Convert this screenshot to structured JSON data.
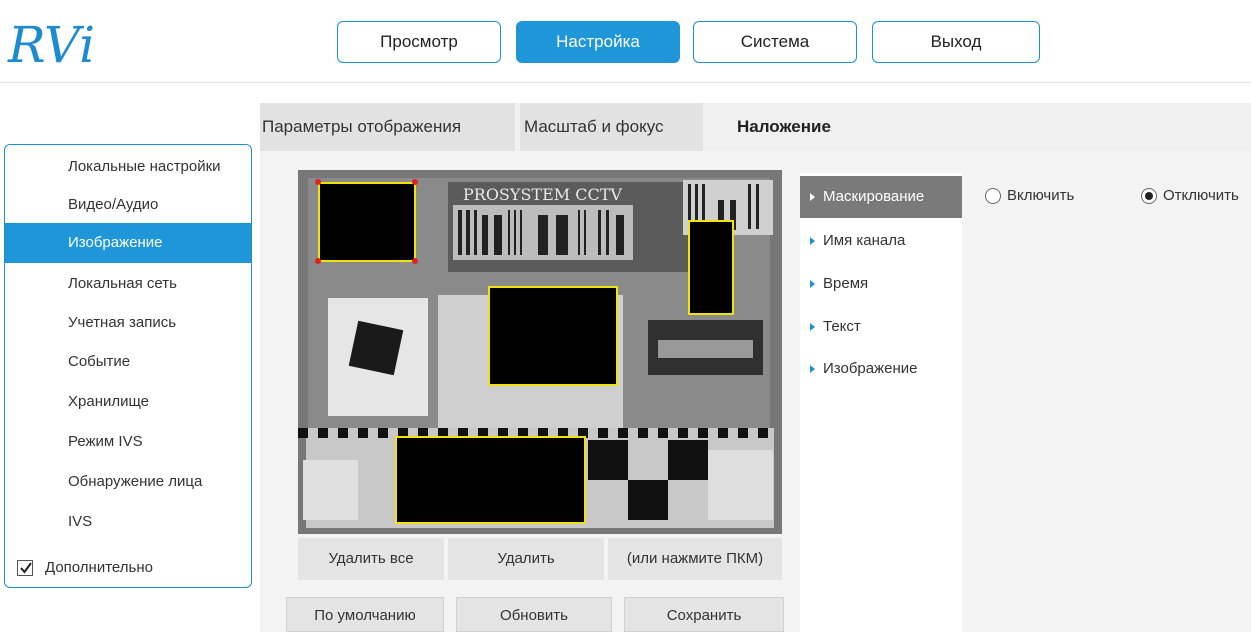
{
  "logo_text": "RVi",
  "colors": {
    "accent": "#1e96d8",
    "mask_border": "#f1e30a",
    "active_overlay": "#7a7a7a"
  },
  "top_nav": [
    "Просмотр",
    "Настройка",
    "Система",
    "Выход"
  ],
  "top_nav_active": "Настройка",
  "tabs": [
    "Параметры отображения",
    "Масштаб и фокус",
    "Наложение"
  ],
  "tab_active": "Наложение",
  "sidebar": {
    "items": [
      "Локальные настройки",
      "Видео/Аудио",
      "Изображение",
      "Локальная сеть",
      "Учетная запись",
      "Событие",
      "Хранилище",
      "Режим IVS",
      "Обнаружение лица",
      "IVS"
    ],
    "active": "Изображение",
    "advanced": {
      "label": "Дополнительно",
      "checked": true
    }
  },
  "video": {
    "overlay_text": "PROSYSTEM CCTV",
    "buttons": [
      "Удалить все",
      "Удалить",
      "(или нажмите ПКМ)"
    ]
  },
  "bottom_buttons": [
    "По умолчанию",
    "Обновить",
    "Сохранить"
  ],
  "overlay_menu": {
    "items": [
      "Маскирование",
      "Имя канала",
      "Время",
      "Текст",
      "Изображение"
    ],
    "active": "Маскирование"
  },
  "masking": {
    "options": [
      "Включить",
      "Отключить"
    ],
    "selected": "Отключить"
  }
}
